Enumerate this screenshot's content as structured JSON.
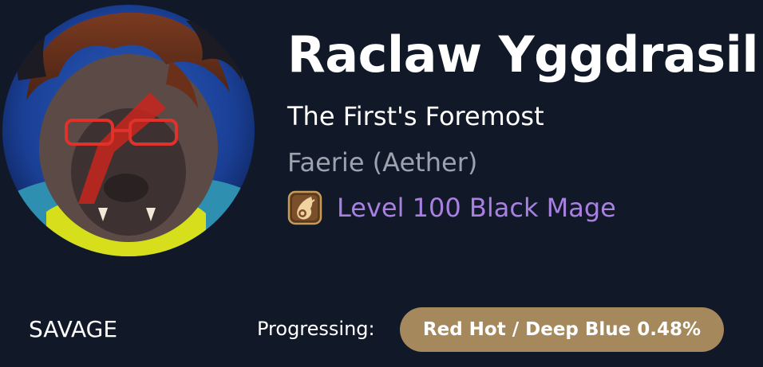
{
  "character": {
    "name": "Raclaw Yggdrasil",
    "title": "The First's Foremost",
    "server": "Faerie (Aether)",
    "job_line": "Level 100 Black Mage",
    "job_icon": "black-mage-fire-icon",
    "avatar": "character-portrait"
  },
  "progress": {
    "section": "SAVAGE",
    "label": "Progressing:",
    "value": "Red Hot / Deep Blue 0.48%"
  },
  "colors": {
    "background": "#111827",
    "job_text": "#a881e0",
    "server_text": "#9ca3af",
    "badge": "#a5895d"
  }
}
